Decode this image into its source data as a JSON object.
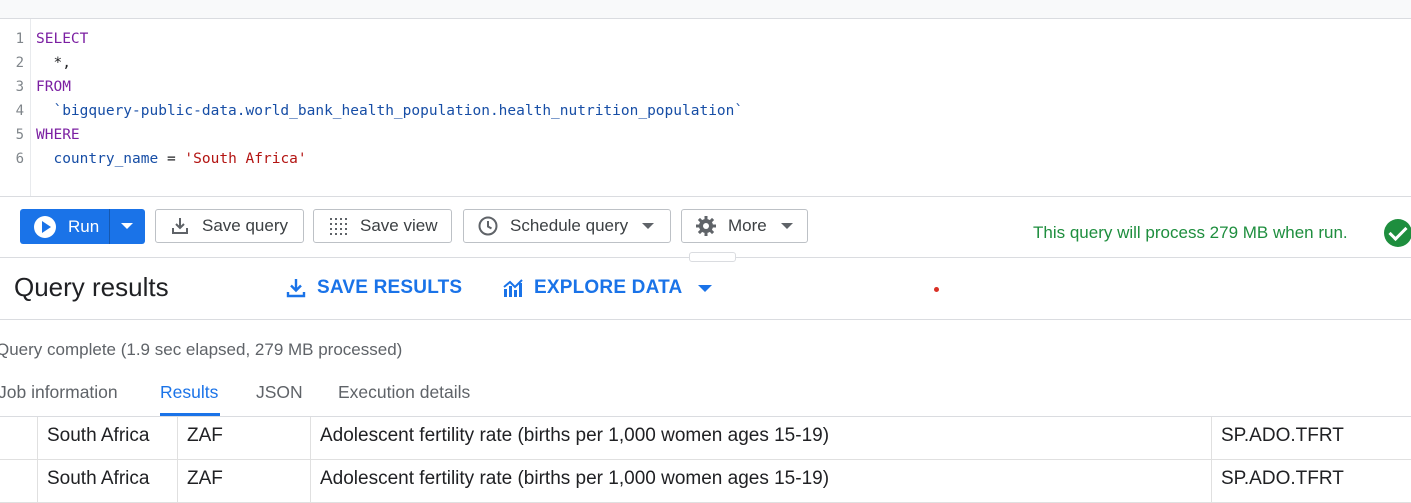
{
  "editor": {
    "line_numbers": [
      "1",
      "2",
      "3",
      "4",
      "5",
      "6"
    ],
    "lines": {
      "l1_kw": "SELECT",
      "l2": "  *,",
      "l3_kw": "FROM",
      "l4_ident": "  `bigquery-public-data.world_bank_health_population.health_nutrition_population`",
      "l5_kw": "WHERE",
      "l6_ident": "  country_name",
      "l6_op": " = ",
      "l6_str": "'South Africa'"
    }
  },
  "toolbar": {
    "run_label": "Run",
    "save_query_label": "Save query",
    "save_view_label": "Save view",
    "schedule_query_label": "Schedule query",
    "more_label": "More",
    "status_text": "This query will process 279 MB when run."
  },
  "results": {
    "title": "Query results",
    "save_results_label": "SAVE RESULTS",
    "explore_data_label": "EXPLORE DATA",
    "complete_text": "Query complete (1.9 sec elapsed, 279 MB processed)",
    "tabs": [
      "Job information",
      "Results",
      "JSON",
      "Execution details"
    ],
    "active_tab": "Results",
    "rows": [
      {
        "country": "South Africa",
        "code": "ZAF",
        "indicator": "Adolescent fertility rate (births per 1,000 women ages 15-19)",
        "indicator_code": "SP.ADO.TFRT"
      },
      {
        "country": "South Africa",
        "code": "ZAF",
        "indicator": "Adolescent fertility rate (births per 1,000 women ages 15-19)",
        "indicator_code": "SP.ADO.TFRT"
      }
    ]
  },
  "colors": {
    "accent": "#1a73e8",
    "success": "#1e8e3e",
    "keyword": "#7b1fa2",
    "string": "#b31412"
  }
}
